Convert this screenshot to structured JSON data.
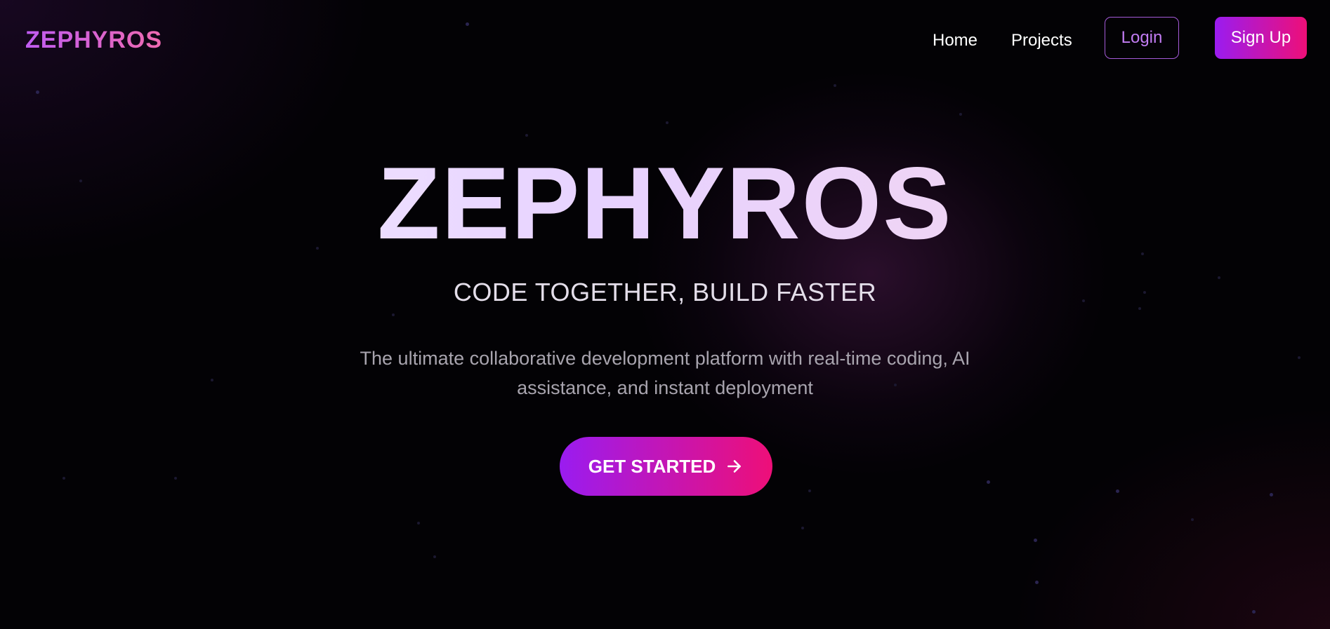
{
  "header": {
    "logo": "ZEPHYROS",
    "nav": {
      "home": "Home",
      "projects": "Projects",
      "login": "Login",
      "signup": "Sign Up"
    }
  },
  "hero": {
    "title": "ZEPHYROS",
    "tagline": "CODE TOGETHER, BUILD FASTER",
    "description": "The ultimate collaborative development platform with real-time coding, AI assistance, and instant deployment",
    "cta_label": "GET STARTED",
    "cta_icon": "arrow-right-icon"
  },
  "colors": {
    "brand_gradient_start": "#9a1cf0",
    "brand_gradient_end": "#ee0f78",
    "background": "#030205",
    "login_accent": "#c27cf3"
  }
}
